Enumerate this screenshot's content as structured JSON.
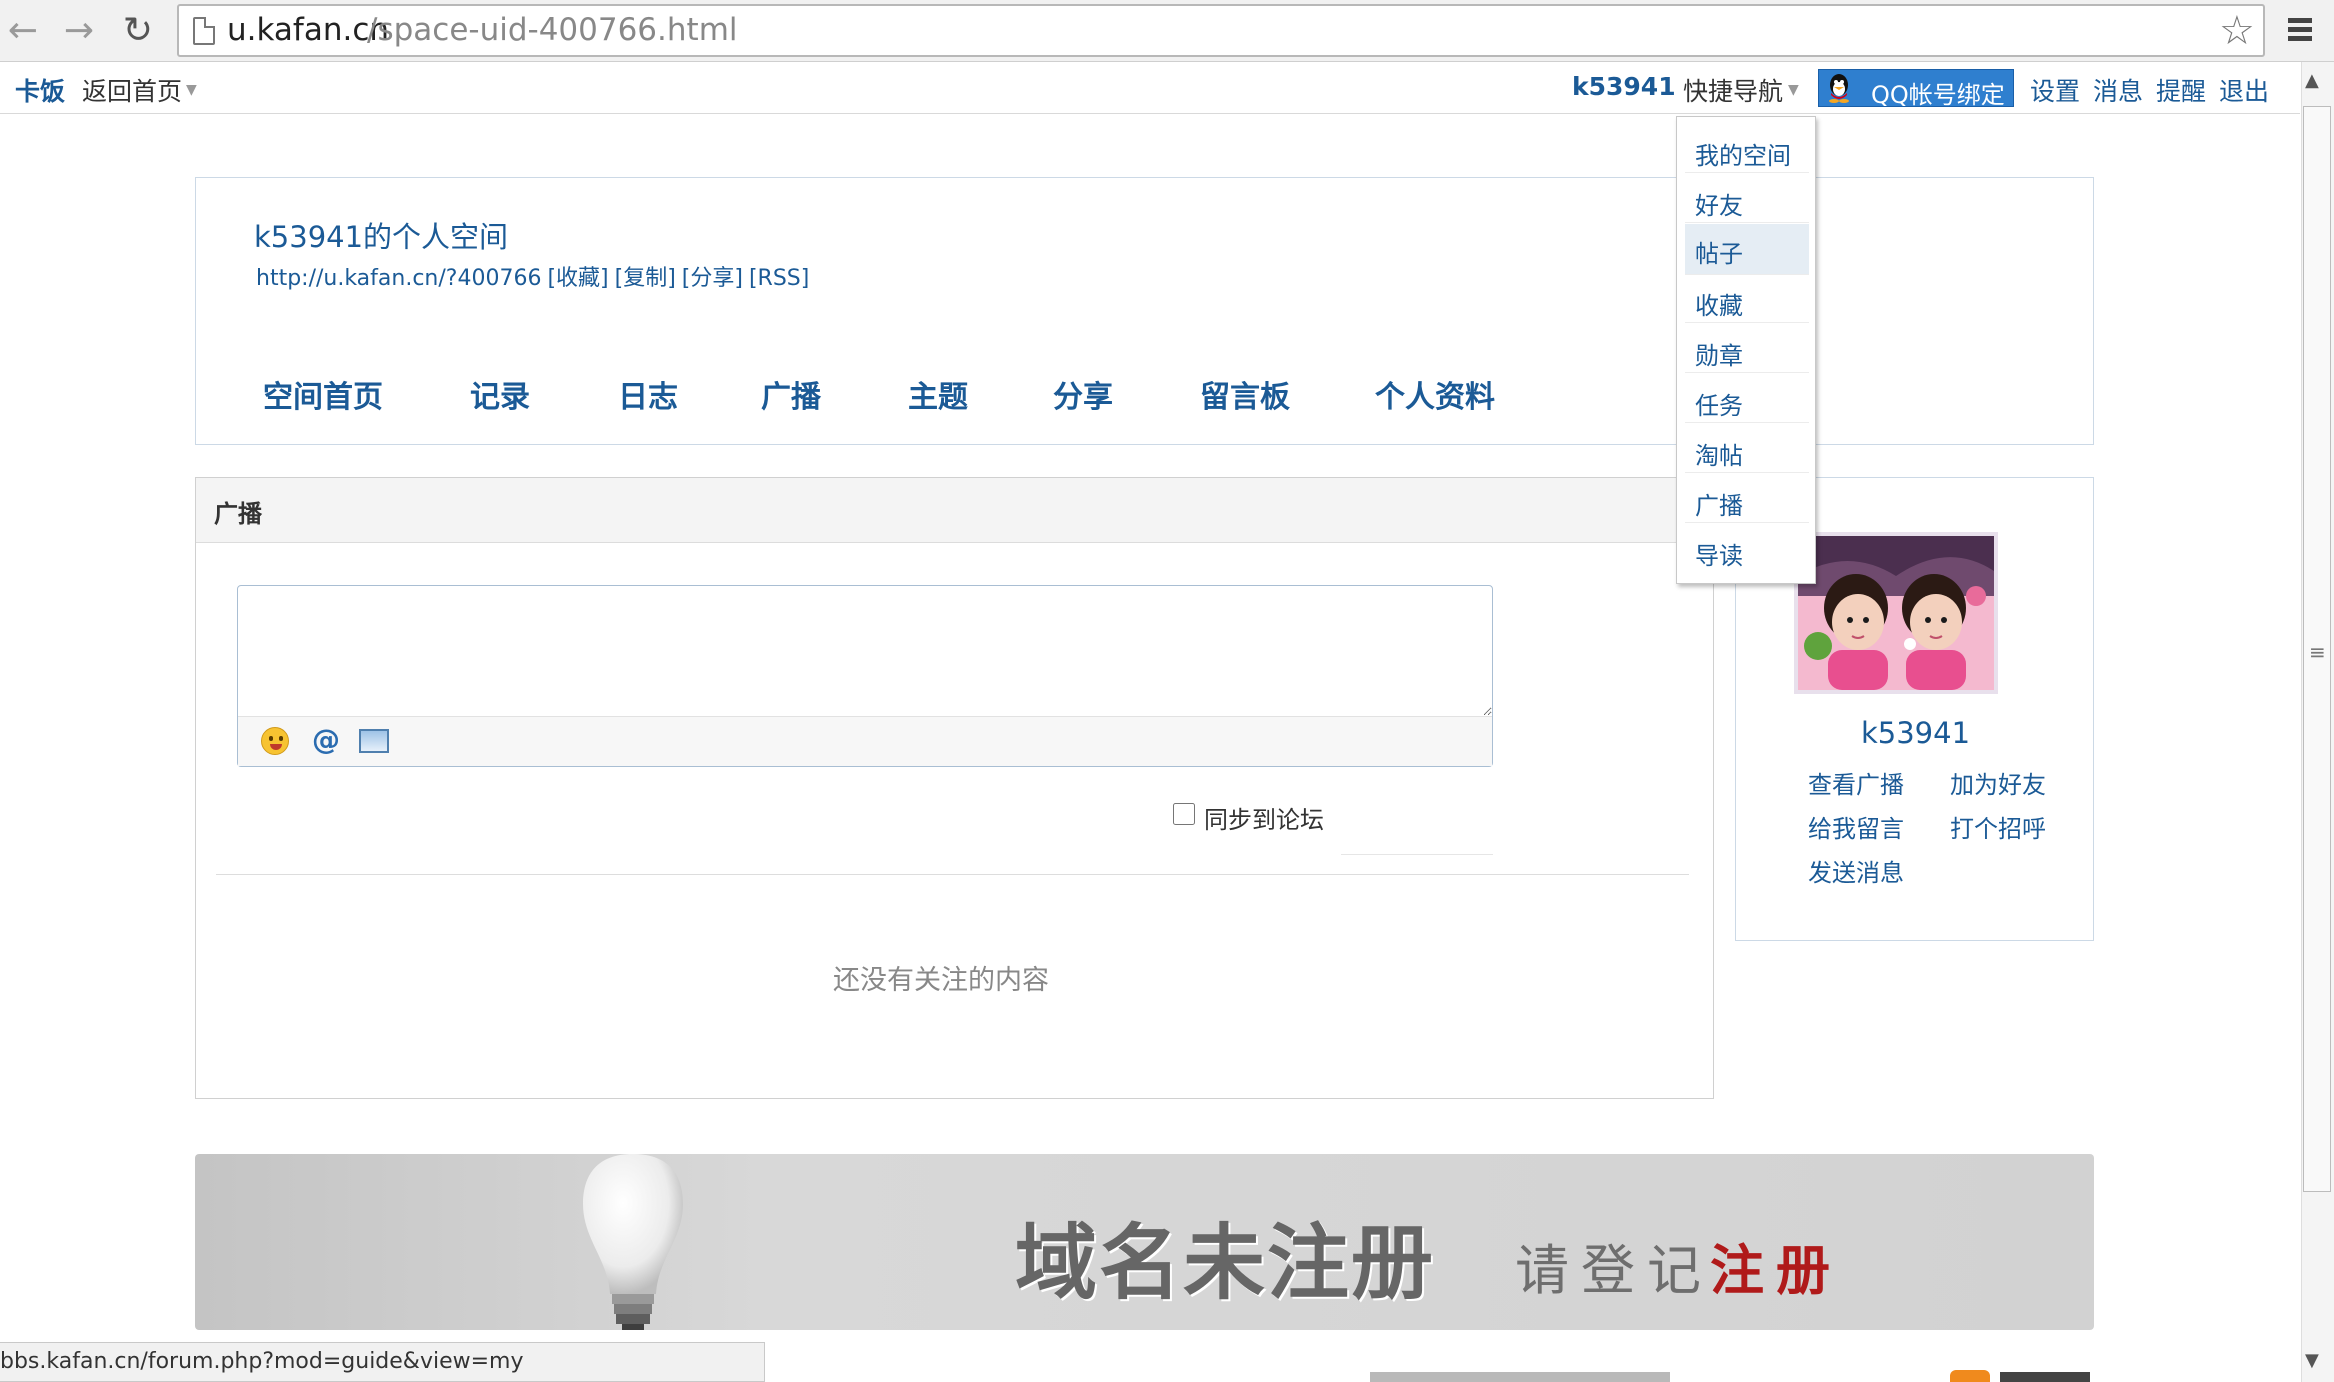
{
  "browser": {
    "url_host": "u.kafan.cn",
    "url_path": "/space-uid-400766.html",
    "status_url": "bbs.kafan.cn/forum.php?mod=guide&view=my"
  },
  "toolbar": {
    "site_name": "卡饭",
    "back_home": "返回首页",
    "username": "k53941",
    "quick_nav": "快捷导航",
    "qq_bind": "QQ帐号绑定",
    "settings": "设置",
    "messages": "消息",
    "reminders": "提醒",
    "logout": "退出"
  },
  "dropdown": {
    "items": [
      "我的空间",
      "好友",
      "帖子",
      "收藏",
      "勋章",
      "任务",
      "淘帖",
      "广播",
      "导读"
    ],
    "active": "帖子"
  },
  "space": {
    "title": "k53941的个人空间",
    "url": "http://u.kafan.cn/?400766",
    "actions": [
      "[收藏]",
      "[复制]",
      "[分享]",
      "[RSS]"
    ],
    "nav": [
      "空间首页",
      "记录",
      "日志",
      "广播",
      "主题",
      "分享",
      "留言板",
      "个人资料"
    ]
  },
  "broadcast": {
    "title": "广播",
    "sync_label": "同步到论坛",
    "empty_text": "还没有关注的内容"
  },
  "profile": {
    "name": "k53941",
    "links": [
      "查看广播",
      "加为好友",
      "给我留言",
      "打个招呼",
      "发送消息"
    ]
  },
  "banner": {
    "main": "域名未注册",
    "sub_plain": "请登记",
    "sub_red": "注册"
  },
  "icons": [
    "back-arrow-icon",
    "forward-arrow-icon",
    "reload-icon",
    "page-icon",
    "star-icon",
    "menu-icon",
    "qq-penguin-icon",
    "emoji-icon",
    "at-icon",
    "image-icon",
    "lightbulb-icon"
  ],
  "colors": {
    "link": "#1b5a96",
    "qq_button": "#2f7fcf",
    "banner_red": "#b01a1a"
  }
}
